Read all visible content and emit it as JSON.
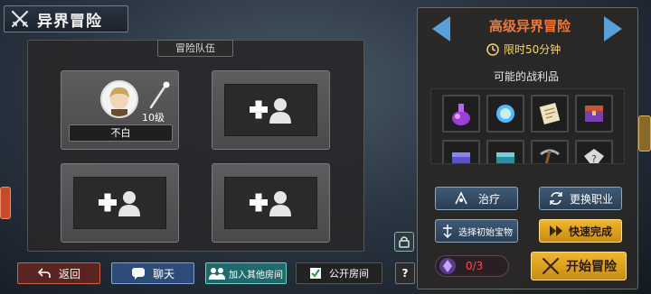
{
  "title": {
    "text": "异界冒险",
    "icon": "crossed-swords-icon"
  },
  "party": {
    "header": "冒险队伍",
    "member": {
      "name": "不白",
      "level": "10级"
    },
    "empty_icon": "add-member-icon"
  },
  "dungeon": {
    "title": "高级异界冒险",
    "timer": "限时50分钟"
  },
  "loot": {
    "title": "可能的战利品",
    "items": [
      "purple-potion-icon",
      "blue-orb-icon",
      "scroll-icon",
      "treasure-chest-icon",
      "blue-chest-icon",
      "teal-chest-icon",
      "pickaxe-icon",
      "mystery-box-icon"
    ]
  },
  "actions": {
    "heal": "治疗",
    "change_job": "更换职业",
    "choose_treasure": "选择初始宝物",
    "quick_finish": "快速完成",
    "counter": "0/3",
    "start": "开始冒险"
  },
  "bottom": {
    "back": "返回",
    "chat": "聊天",
    "join_room": "加入其他房间",
    "public_room": "公开房间",
    "help": "?"
  },
  "colors": {
    "accent_orange": "#f07836",
    "timer_gold": "#f6d76a",
    "gold_button": "#e3a81e",
    "blue_button": "#3a5570"
  }
}
